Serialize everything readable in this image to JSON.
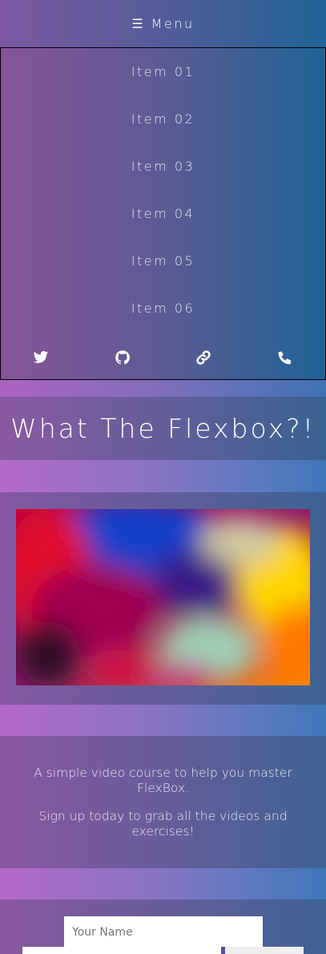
{
  "menu": {
    "icon": "hamburger-icon",
    "label": "☰ Menu",
    "items": [
      "Item 01",
      "Item 02",
      "Item 03",
      "Item 04",
      "Item 05",
      "Item 06"
    ],
    "socials": [
      "twitter-icon",
      "github-icon",
      "link-icon",
      "phone-icon"
    ]
  },
  "hero": {
    "title": "What The Flexbox?!"
  },
  "description": {
    "line1": "A simple video course to help you master FlexBox.",
    "line2": "Sign up today to grab all the videos and exercises!"
  },
  "signup": {
    "name_placeholder": "Your Name"
  }
}
